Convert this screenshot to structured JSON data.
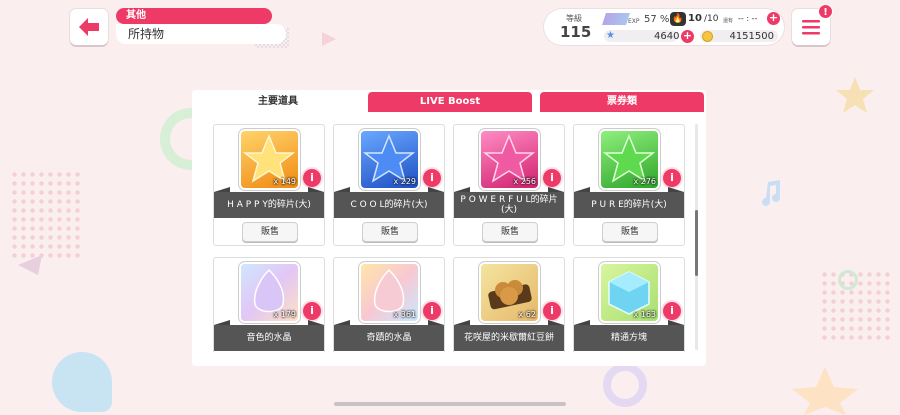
{
  "header": {
    "category": "其他",
    "subtitle": "所持物"
  },
  "status": {
    "level_label": "等級",
    "level": "115",
    "exp_label": "EXP",
    "exp_percent": "57 %",
    "ap_current": "10",
    "ap_max": "/10",
    "ap_note": "還有",
    "ap_timer": "-- : --",
    "stars": "4640",
    "coins": "4151500"
  },
  "menu": {
    "badge": "!"
  },
  "tabs": [
    {
      "label": "主要道具",
      "active": true
    },
    {
      "label": "LIVE Boost",
      "active": false
    },
    {
      "label": "票券類",
      "active": false
    }
  ],
  "items": [
    {
      "name": "H A P P Y的碎片(大)",
      "qty": "x 149",
      "sell": "販售",
      "color": "#f7a21b",
      "kind": "star"
    },
    {
      "name": "C O O L的碎片(大)",
      "qty": "x 229",
      "sell": "販售",
      "color": "#2f6fe0",
      "kind": "star"
    },
    {
      "name": "P O W E R F U L的碎片(大)",
      "qty": "x 256",
      "sell": "販售",
      "color": "#e8408f",
      "kind": "star"
    },
    {
      "name": "P U R E的碎片(大)",
      "qty": "x 276",
      "sell": "販售",
      "color": "#4bc83b",
      "kind": "star"
    },
    {
      "name": "音色的水晶",
      "qty": "x 179",
      "sell": "",
      "color": "#c9b8f0",
      "kind": "crystal"
    },
    {
      "name": "奇蹟的水晶",
      "qty": "x 361",
      "sell": "",
      "color": "#f3c0c8",
      "kind": "crystal"
    },
    {
      "name": "花咲屋的米歇爾紅豆餅",
      "qty": "x 62",
      "sell": "",
      "color": "#8a5a2b",
      "kind": "food"
    },
    {
      "name": "精通方塊",
      "qty": "x 163",
      "sell": "",
      "color": "#7fd8f0",
      "kind": "cube"
    }
  ],
  "info_icon": "i",
  "colors": {
    "accent": "#ee3a66",
    "background": "#fbeeee",
    "name_bar": "#555555"
  }
}
